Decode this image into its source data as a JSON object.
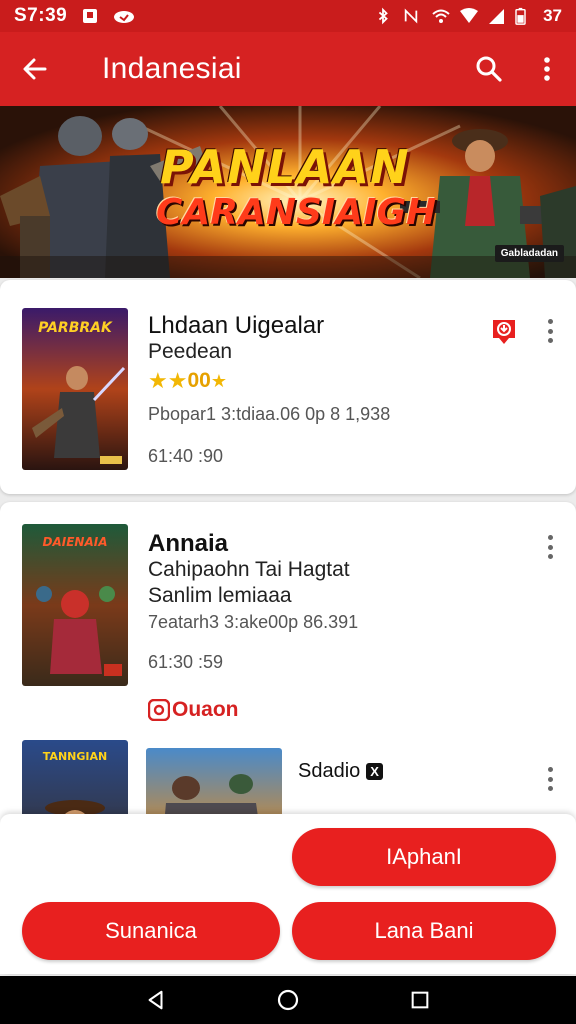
{
  "status_bar": {
    "time": "S7:39",
    "battery": "37"
  },
  "app_bar": {
    "title": "Indanesiai"
  },
  "banner": {
    "title": "PANLAAN",
    "subtitle": "CARANSIAIGH",
    "badge": "Gabladadan"
  },
  "games": [
    {
      "title": "Lhdaan Uigealar",
      "subtitle": "Peedean",
      "rating_text": "00",
      "meta1": "Pbopar1 3:tdiaa.06 0p 8 1,938",
      "meta2": "61:40 :90"
    },
    {
      "title": "Annaia",
      "subtitle_line1": "Cahipaohn Tai Hagtat",
      "subtitle_line2": "Sanlim lemiaaa",
      "meta1": "7eatarh3 3:ake00p 86.391",
      "meta2": "61:30 :59",
      "tag": "Ouaon"
    },
    {
      "studio_label": "Sdadio",
      "studio_badge": "X"
    }
  ],
  "action_sheet": {
    "primary": "IAphanI",
    "secondary_left": "Sunanica",
    "secondary_right": "Lana Bani"
  },
  "colors": {
    "status_bar": "#c91c1c",
    "app_bar": "#d62222",
    "accent": "#e8201f",
    "star": "#f2b705"
  }
}
